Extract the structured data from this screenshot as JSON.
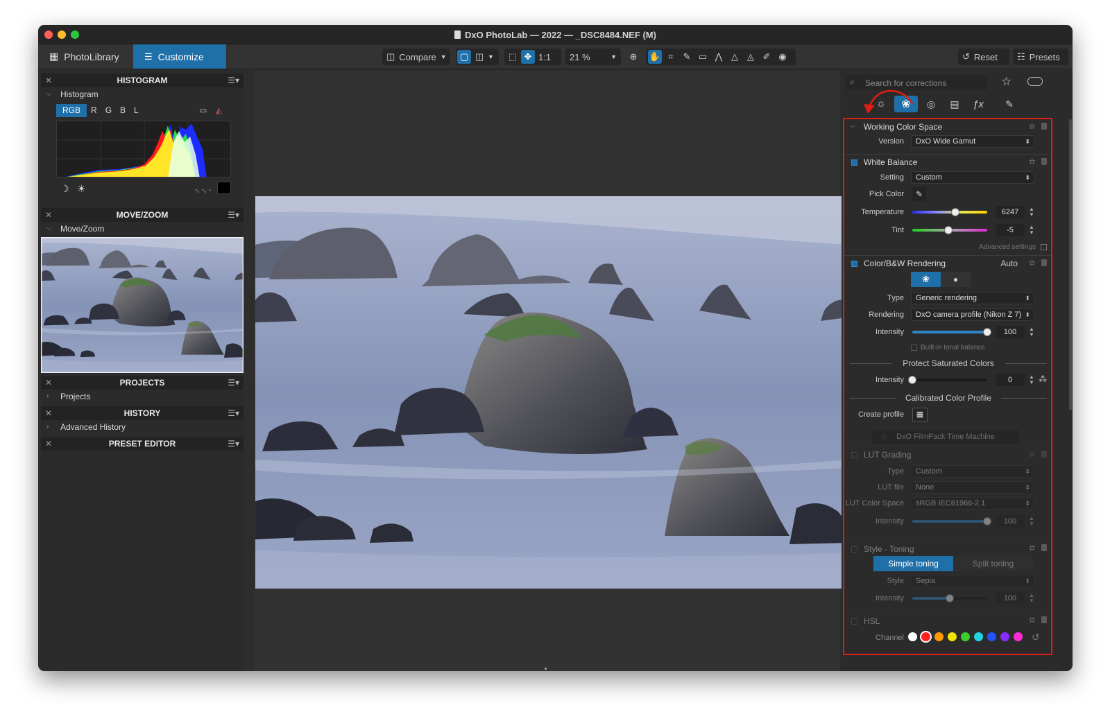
{
  "window": {
    "title": "DxO PhotoLab — 2022 — _DSC8484.NEF (M)",
    "traffic_lights": [
      "#ff5f57",
      "#febc2e",
      "#28c840"
    ]
  },
  "toolbar": {
    "tab_library": "PhotoLibrary",
    "tab_customize": "Customize",
    "compare": "Compare",
    "ratio": "1:1",
    "zoom": "21 %",
    "reset": "Reset",
    "presets": "Presets",
    "accent_color": "#1f6fa8"
  },
  "left": {
    "histogram": {
      "title": "HISTOGRAM",
      "sub": "Histogram",
      "channels": [
        "RGB",
        "R",
        "G",
        "B",
        "L"
      ],
      "readout": "-, -, -"
    },
    "movezoom": {
      "title": "MOVE/ZOOM",
      "sub": "Move/Zoom"
    },
    "projects": {
      "title": "PROJECTS",
      "sub": "Projects"
    },
    "history": {
      "title": "HISTORY",
      "sub": "Advanced History"
    },
    "preset": {
      "title": "PRESET EDITOR"
    }
  },
  "right": {
    "search_placeholder": "Search for corrections",
    "highlight_color": "#e11d12",
    "wcs": {
      "title": "Working Color Space",
      "version_label": "Version",
      "version": "DxO Wide Gamut"
    },
    "wb": {
      "title": "White Balance",
      "setting_label": "Setting",
      "setting": "Custom",
      "pick_label": "Pick Color",
      "temp_label": "Temperature",
      "temp": "6247",
      "temp_level": 0.57,
      "tint_label": "Tint",
      "tint": "-5",
      "tint_level": 0.48,
      "advanced": "Advanced settings"
    },
    "cbw": {
      "title": "Color/B&W Rendering",
      "status": "Auto",
      "type_label": "Type",
      "type": "Generic rendering",
      "rendering_label": "Rendering",
      "rendering": "DxO camera profile (Nikon Z 7)",
      "intensity_label": "Intensity",
      "intensity": "100",
      "intensity_level": 1.0,
      "tonal": "Built-in tonal balance",
      "protect": "Protect Saturated Colors",
      "protect_intensity": "0",
      "protect_level": 0.0,
      "calibrated": "Calibrated Color Profile",
      "create_profile": "Create profile",
      "filmpack": "DxO FilmPack Time Machine"
    },
    "lut": {
      "title": "LUT Grading",
      "type_label": "Type",
      "type": "Custom",
      "file_label": "LUT file",
      "file": "None",
      "space_label": "LUT Color Space",
      "space": "sRGB IEC61966-2.1",
      "intensity_label": "Intensity",
      "intensity": "100",
      "intensity_level": 1.0
    },
    "style": {
      "title": "Style - Toning",
      "simple": "Simple toning",
      "split": "Split toning",
      "style_label": "Style",
      "style": "Sepia",
      "intensity_label": "Intensity",
      "intensity": "100",
      "intensity_level": 0.5
    },
    "hsl": {
      "title": "HSL",
      "channel_label": "Channel",
      "channels": [
        "#ffffff",
        "#ff2020",
        "#ff9a00",
        "#f2e400",
        "#3ccf2c",
        "#1fd3e0",
        "#2352ff",
        "#8b2cff",
        "#ff2bd6"
      ]
    }
  }
}
